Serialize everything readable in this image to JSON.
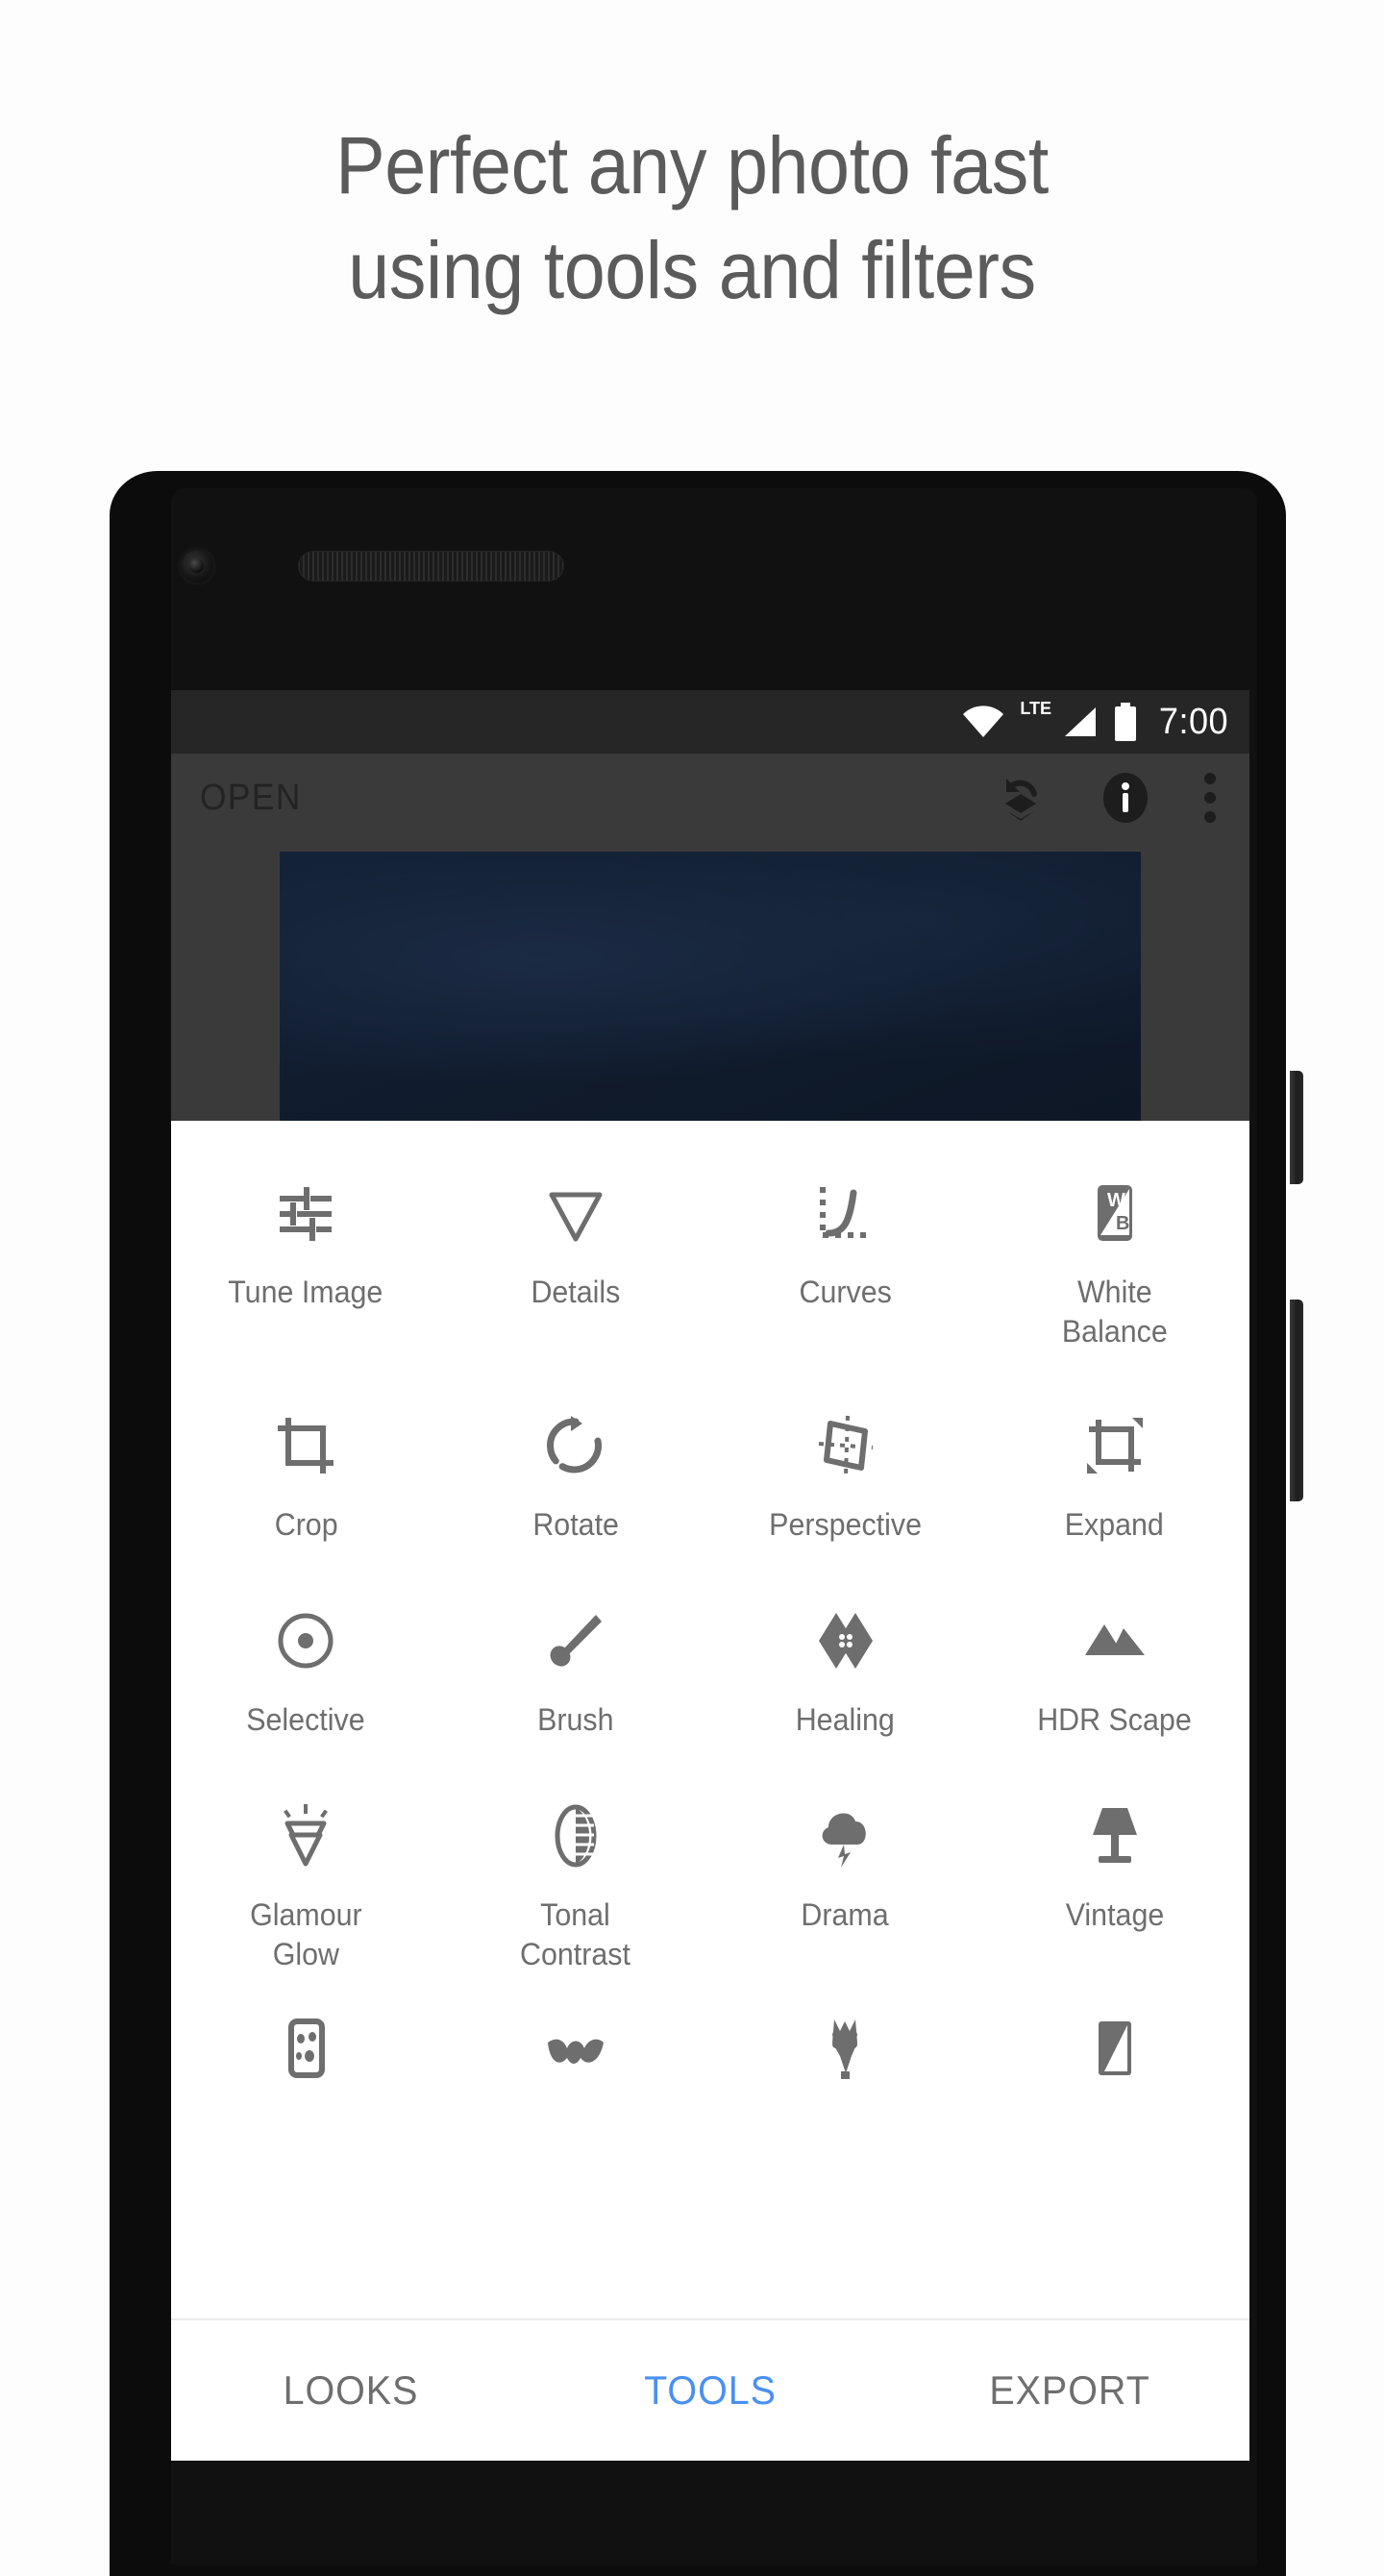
{
  "headline": {
    "line1": "Perfect any photo fast",
    "line2": "using tools and filters",
    "color": "#5b5b5b"
  },
  "phone": {
    "hardware": {
      "front_camera": "front-camera",
      "speaker": "earpiece-speaker",
      "power_button": "power-button",
      "volume_button": "volume-button"
    }
  },
  "statusbar": {
    "wifi_icon": "wifi-icon",
    "network_label": "LTE",
    "signal_icon": "cellular-signal-icon",
    "battery_icon": "battery-full-icon",
    "clock": "7:00",
    "background": "#262626"
  },
  "app_toolbar": {
    "title": "OPEN",
    "background": "#3a3a3a",
    "actions": [
      {
        "name": "stacks-undo-icon",
        "label": "Stacks"
      },
      {
        "name": "info-icon",
        "label": "Info"
      },
      {
        "name": "overflow-menu-icon",
        "label": "More options"
      }
    ]
  },
  "preview": {
    "name": "image-preview",
    "background": "#3a3a3a",
    "image_color": "#101b2c"
  },
  "tools": {
    "rows": [
      [
        {
          "label": "Tune Image",
          "icon": "tune-image-icon"
        },
        {
          "label": "Details",
          "icon": "details-icon"
        },
        {
          "label": "Curves",
          "icon": "curves-icon"
        },
        {
          "label": "White\nBalance",
          "icon": "white-balance-icon"
        }
      ],
      [
        {
          "label": "Crop",
          "icon": "crop-icon"
        },
        {
          "label": "Rotate",
          "icon": "rotate-icon"
        },
        {
          "label": "Perspective",
          "icon": "perspective-icon"
        },
        {
          "label": "Expand",
          "icon": "expand-icon"
        }
      ],
      [
        {
          "label": "Selective",
          "icon": "selective-icon"
        },
        {
          "label": "Brush",
          "icon": "brush-icon"
        },
        {
          "label": "Healing",
          "icon": "healing-icon"
        },
        {
          "label": "HDR Scape",
          "icon": "hdr-scape-icon"
        }
      ],
      [
        {
          "label": "Glamour\nGlow",
          "icon": "glamour-glow-icon"
        },
        {
          "label": "Tonal\nContrast",
          "icon": "tonal-contrast-icon"
        },
        {
          "label": "Drama",
          "icon": "drama-icon"
        },
        {
          "label": "Vintage",
          "icon": "vintage-icon"
        }
      ],
      [
        {
          "label": "",
          "icon": "grainy-film-icon"
        },
        {
          "label": "",
          "icon": "retrolux-icon"
        },
        {
          "label": "",
          "icon": "grunge-icon"
        },
        {
          "label": "",
          "icon": "double-exposure-icon"
        }
      ]
    ],
    "label_color": "#6e6e6e",
    "icon_color": "#6e6e6e"
  },
  "tabbar": {
    "tabs": [
      {
        "label": "LOOKS",
        "active": false
      },
      {
        "label": "TOOLS",
        "active": true
      },
      {
        "label": "EXPORT",
        "active": false
      }
    ],
    "active_color": "#4a90f0",
    "inactive_color": "#6e6e6e"
  }
}
